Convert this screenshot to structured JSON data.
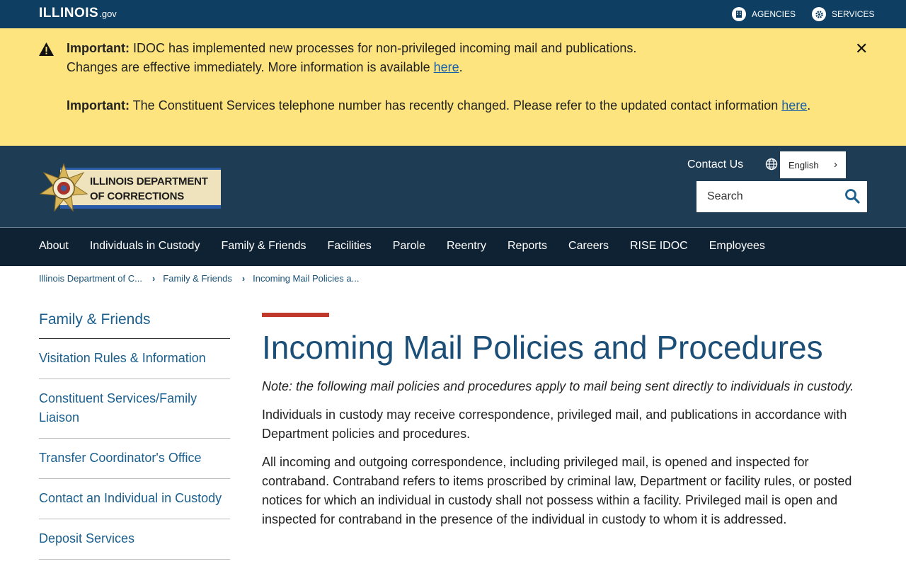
{
  "topbar": {
    "logo_main": "ILLINOIS",
    "logo_suffix": ".gov",
    "agencies": "AGENCIES",
    "services": "SERVICES"
  },
  "alert": {
    "label1": "Important:",
    "text1": " IDOC has implemented new processes for non-privileged incoming mail and publications.",
    "text1b": "Changes are effective immediately. More information is available ",
    "link1": "here",
    "label2": "Important:",
    "text2": " The Constituent Services telephone number has recently changed. Please refer to the updated contact information ",
    "link2": "here"
  },
  "header": {
    "logo_line1": "ILLINOIS DEPARTMENT",
    "logo_line2": "OF CORRECTIONS",
    "contact": "Contact Us",
    "language": "English",
    "search_placeholder": "Search"
  },
  "nav": [
    "About",
    "Individuals in Custody",
    "Family & Friends",
    "Facilities",
    "Parole",
    "Reentry",
    "Reports",
    "Careers",
    "RISE IDOC",
    "Employees"
  ],
  "breadcrumb": [
    "Illinois Department of C...",
    "Family & Friends",
    "Incoming Mail Policies a..."
  ],
  "sidebar": {
    "heading": "Family & Friends",
    "items": [
      "Visitation Rules & Information",
      "Constituent Services/Family Liaison",
      "Transfer Coordinator's Office",
      "Contact an Individual in Custody",
      "Deposit Services"
    ]
  },
  "main": {
    "title": "Incoming Mail Policies and Procedures",
    "note": "Note: the following mail policies and procedures apply to mail being sent directly to individuals in custody.",
    "para1": "Individuals in custody may receive correspondence, privileged mail, and publications in accordance with Department policies and procedures.",
    "para2": "All incoming and outgoing correspondence, including privileged mail, is opened and inspected for contraband. Contraband refers to items proscribed by criminal law, Department or facility rules, or posted notices for which an individual in custody shall not possess within a facility. Privileged mail is open and inspected for contraband in the presence of the individual in custody to whom it is addressed."
  },
  "colors": {
    "topbar": "#0e3e62",
    "alert": "#fde47f",
    "header": "#1f3c55",
    "nav": "#0f2234",
    "accent_rule": "#c0392b",
    "title": "#1c4f78"
  }
}
